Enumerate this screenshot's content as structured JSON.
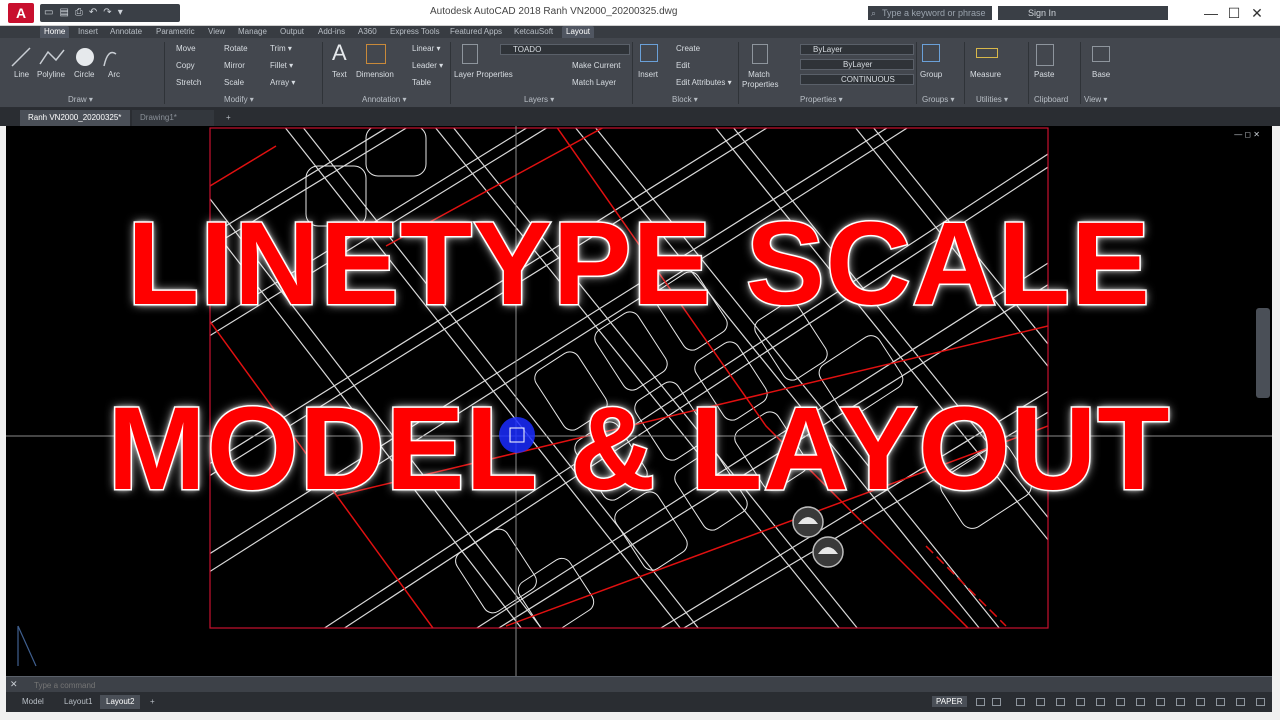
{
  "window": {
    "app_logo": "A",
    "title": "Autodesk AutoCAD 2018     Ranh VN2000_20200325.dwg",
    "search_placeholder": "Type a keyword or phrase",
    "signin": "Sign In",
    "controls": {
      "minimize": "—",
      "maximize": "☐",
      "close": "✕"
    }
  },
  "ribbon_tabs": [
    "Home",
    "Insert",
    "Annotate",
    "Parametric",
    "View",
    "Manage",
    "Output",
    "Add-ins",
    "A360",
    "Express Tools",
    "Featured Apps",
    "KetcauSoft",
    "Layout"
  ],
  "ribbon": {
    "draw": {
      "line": "Line",
      "polyline": "Polyline",
      "circle": "Circle",
      "arc": "Arc",
      "label": "Draw ▾"
    },
    "modify": {
      "move": "Move",
      "rotate": "Rotate",
      "trim": "Trim ▾",
      "copy": "Copy",
      "mirror": "Mirror",
      "fillet": "Fillet ▾",
      "stretch": "Stretch",
      "scale": "Scale",
      "array": "Array ▾",
      "label": "Modify ▾"
    },
    "annotation": {
      "text": "Text",
      "dimension": "Dimension",
      "linear": "Linear ▾",
      "leader": "Leader ▾",
      "table": "Table",
      "label": "Annotation ▾"
    },
    "layers": {
      "layer_properties": "Layer Properties",
      "current_layer": "TOADO",
      "make_current": "Make Current",
      "match_layer": "Match Layer",
      "label": "Layers ▾"
    },
    "block": {
      "insert": "Insert",
      "create": "Create",
      "edit": "Edit",
      "edit_attributes": "Edit Attributes ▾",
      "label": "Block ▾"
    },
    "properties": {
      "match_properties": "Match Properties",
      "color": "ByLayer",
      "lineweight": "ByLayer",
      "linetype": "CONTINUOUS",
      "label": "Properties ▾"
    },
    "groups": {
      "group": "Group",
      "label": "Groups ▾"
    },
    "utilities": {
      "measure": "Measure",
      "label": "Utilities ▾"
    },
    "clipboard": {
      "paste": "Paste",
      "label": "Clipboard"
    },
    "view": {
      "base": "Base",
      "label": "View ▾"
    }
  },
  "file_tabs": [
    "Ranh VN2000_20200325*",
    "Drawing1*"
  ],
  "file_tab_add": "+",
  "viewport_controls": "— ◻ ✕",
  "headline": {
    "line1": "LINETYPE SCALE",
    "line2": "MODEL & LAYOUT"
  },
  "command": {
    "close": "✕",
    "placeholder": "Type a command"
  },
  "layout_tabs": [
    "Model",
    "Layout1",
    "Layout2"
  ],
  "layout_tab_add": "+",
  "status": {
    "paper": "PAPER"
  },
  "colors": {
    "accent_red": "#ff0000",
    "cursor_blue": "#1a2cff",
    "ribbon_bg": "#43474e",
    "canvas_bg": "#000000"
  }
}
